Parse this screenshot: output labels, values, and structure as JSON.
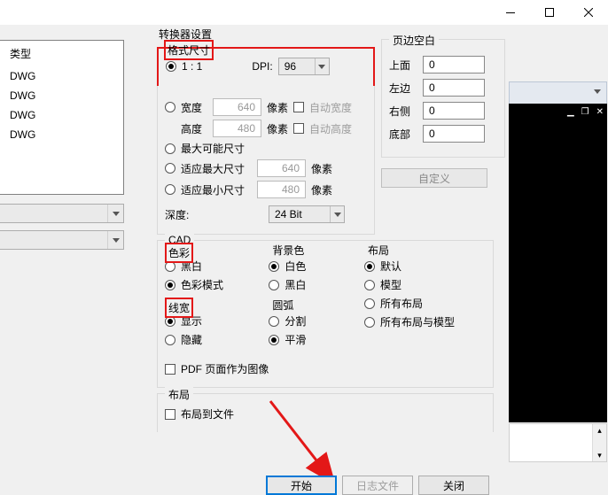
{
  "titlebar": {
    "min": "—",
    "max": "□",
    "close": "✕"
  },
  "left": {
    "header": "类型",
    "items": [
      "DWG",
      "DWG",
      "DWG",
      "DWG"
    ]
  },
  "bg": {
    "chevdown": "▾"
  },
  "conv": {
    "title": "转换器设置",
    "formatSize": {
      "legend": "格式尺寸",
      "one_to_one": "1 : 1",
      "dpi_label": "DPI:",
      "dpi_value": "96",
      "width_label": "宽度",
      "width_value": "640",
      "width_px": "像素",
      "auto_width": "自动宽度",
      "height_label": "高度",
      "height_value": "480",
      "height_px": "像素",
      "auto_height": "自动高度",
      "max_possible": "最大可能尺寸",
      "fit_max": "适应最大尺寸",
      "fit_max_val": "640",
      "fit_max_px": "像素",
      "fit_min": "适应最小尺寸",
      "fit_min_val": "480",
      "fit_min_px": "像素",
      "depth_label": "深度:",
      "depth_value": "24 Bit"
    },
    "cad": {
      "legend": "CAD",
      "color": {
        "legend": "色彩",
        "bw": "黑白",
        "colormode": "色彩模式"
      },
      "bgcolor": {
        "legend": "背景色",
        "white": "白色",
        "black": "黑白"
      },
      "linewidth": {
        "legend": "线宽",
        "show": "显示",
        "hide": "隐藏"
      },
      "arc": {
        "legend": "圆弧",
        "split": "分割",
        "smooth": "平滑"
      },
      "pdf_as_img": "PDF 页面作为图像"
    },
    "layout": {
      "legend": "布局",
      "default": "默认",
      "model": "模型",
      "all": "所有布局",
      "all_with_model": "所有布局与模型",
      "to_file": "布局到文件"
    }
  },
  "margins": {
    "legend": "页边空白",
    "top": "上面",
    "top_v": "0",
    "left": "左边",
    "left_v": "0",
    "right": "右侧",
    "right_v": "0",
    "bottom": "底部",
    "bottom_v": "0",
    "custom": "自定义"
  },
  "buttons": {
    "start": "开始",
    "log": "日志文件",
    "close": "关闭"
  }
}
